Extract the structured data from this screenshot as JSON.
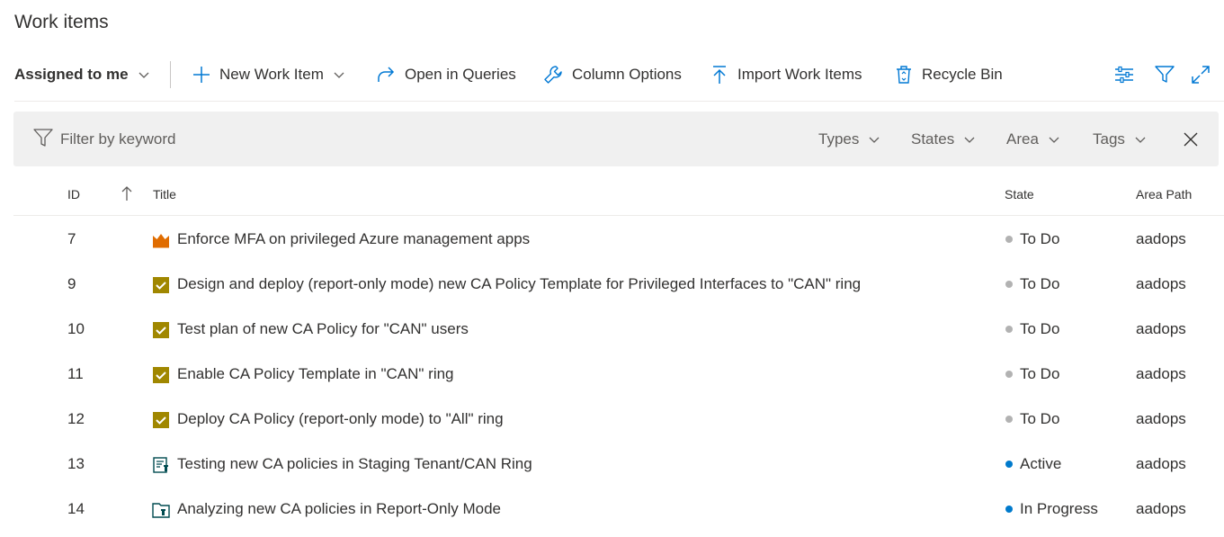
{
  "page": {
    "title": "Work items"
  },
  "toolbar": {
    "pivot_label": "Assigned to me",
    "new_work_item": "New Work Item",
    "open_in_queries": "Open in Queries",
    "column_options": "Column Options",
    "import_work_items": "Import Work Items",
    "recycle_bin": "Recycle Bin",
    "icons": [
      "view-options-icon",
      "filter-icon",
      "fullscreen-icon"
    ]
  },
  "filter": {
    "placeholder": "Filter by keyword",
    "types": "Types",
    "states": "States",
    "area": "Area",
    "tags": "Tags"
  },
  "grid": {
    "columns": {
      "id": "ID",
      "title": "Title",
      "state": "State",
      "area_path": "Area Path"
    },
    "sort": "ID ascending",
    "rows": [
      {
        "id": "7",
        "type": "Epic",
        "icon": "crown-icon",
        "title": "Enforce MFA on privileged Azure management apps",
        "state": "To Do",
        "state_color": "#b2b2b2",
        "area": "aadops"
      },
      {
        "id": "9",
        "type": "Task",
        "icon": "task-checkbox-icon",
        "title": "Design and deploy (report-only mode) new CA Policy Template for Privileged Interfaces to \"CAN\" ring",
        "state": "To Do",
        "state_color": "#b2b2b2",
        "area": "aadops"
      },
      {
        "id": "10",
        "type": "Task",
        "icon": "task-checkbox-icon",
        "title": "Test plan of new CA Policy for \"CAN\" users",
        "state": "To Do",
        "state_color": "#b2b2b2",
        "area": "aadops"
      },
      {
        "id": "11",
        "type": "Task",
        "icon": "task-checkbox-icon",
        "title": "Enable CA Policy Template in \"CAN\" ring",
        "state": "To Do",
        "state_color": "#b2b2b2",
        "area": "aadops"
      },
      {
        "id": "12",
        "type": "Task",
        "icon": "task-checkbox-icon",
        "title": "Deploy CA Policy (report-only mode) to \"All\" ring",
        "state": "To Do",
        "state_color": "#b2b2b2",
        "area": "aadops"
      },
      {
        "id": "13",
        "type": "Test Plan",
        "icon": "test-plan-icon",
        "title": "Testing new CA policies in Staging Tenant/CAN Ring",
        "state": "Active",
        "state_color": "#007acc",
        "area": "aadops"
      },
      {
        "id": "14",
        "type": "Test Suite",
        "icon": "test-suite-icon",
        "title": "Analyzing new CA policies in Report-Only Mode",
        "state": "In Progress",
        "state_color": "#007acc",
        "area": "aadops"
      }
    ]
  },
  "colors": {
    "accent": "#0078d4",
    "task": "#a08700",
    "epic": "#e06c00",
    "test": "#004b50"
  }
}
